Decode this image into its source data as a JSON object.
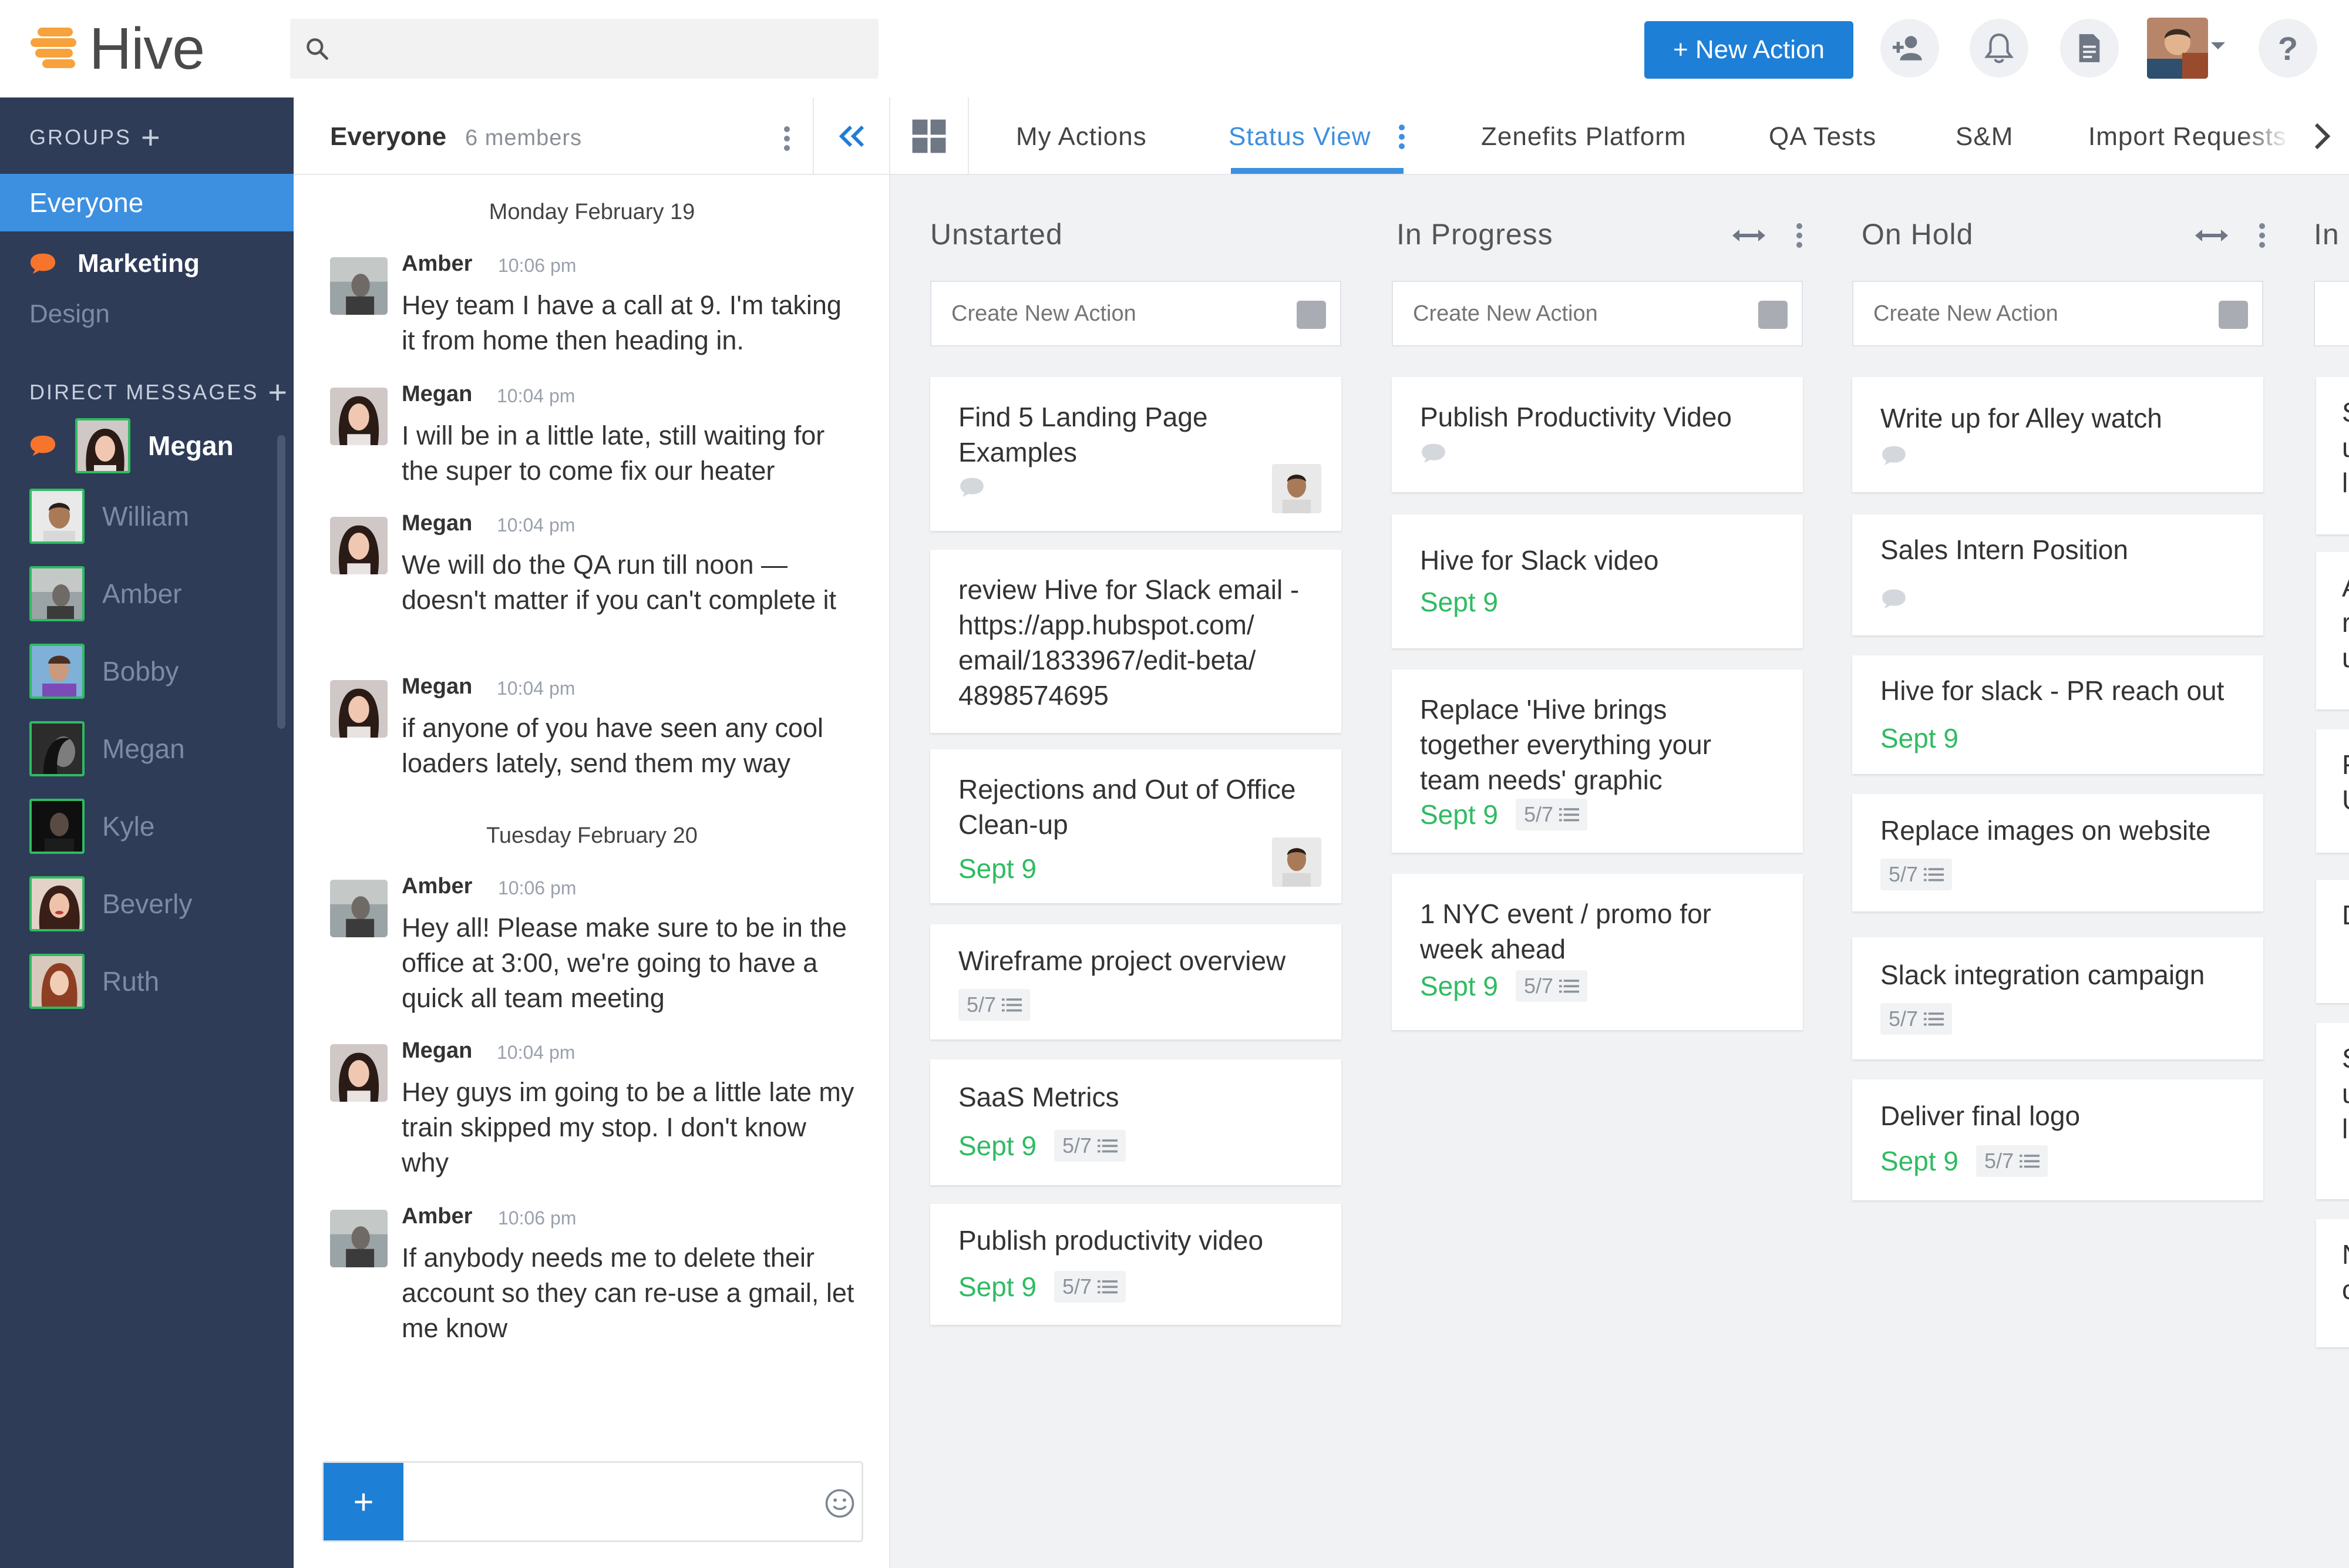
{
  "app": {
    "name": "Hive",
    "brand_color": "#f7a23c",
    "accent_color": "#1e7fd6",
    "done_color": "#2fbb62"
  },
  "topbar": {
    "search_placeholder": "",
    "new_action_label": "+ New Action",
    "icons": [
      "add-user-icon",
      "bell-icon",
      "document-icon",
      "help-icon"
    ],
    "help_label": "?"
  },
  "sidebar": {
    "groups_heading": "GROUPS",
    "groups": [
      {
        "label": "Everyone",
        "selected": true
      },
      {
        "label": "Marketing",
        "unread": true
      },
      {
        "label": "Design"
      }
    ],
    "dm_heading": "DIRECT MESSAGES",
    "direct_messages": [
      {
        "label": "Megan",
        "active": true
      },
      {
        "label": "William"
      },
      {
        "label": "Amber"
      },
      {
        "label": "Bobby"
      },
      {
        "label": "Megan"
      },
      {
        "label": "Kyle"
      },
      {
        "label": "Beverly"
      },
      {
        "label": "Ruth"
      }
    ]
  },
  "chat": {
    "title": "Everyone",
    "members": "6 members",
    "days": [
      {
        "label": "Monday February 19",
        "messages": [
          {
            "author": "Amber",
            "time": "10:06 pm",
            "text": "Hey team I have a call at 9. I'm taking it from home then heading in."
          },
          {
            "author": "Megan",
            "time": "10:04 pm",
            "text": "I will be in a little late, still waiting for the super to come fix our heater"
          },
          {
            "author": "Megan",
            "time": "10:04 pm",
            "text": "We will do the QA run till noon — doesn't matter if you can't complete it"
          },
          {
            "author": "Megan",
            "time": "10:04 pm",
            "text": "if anyone of you have seen any cool loaders lately, send them my way"
          }
        ]
      },
      {
        "label": "Tuesday February 20",
        "messages": [
          {
            "author": "Amber",
            "time": "10:06 pm",
            "text": "Hey all! Please make sure to be in the office at 3:00, we're going to have a quick all team meeting"
          },
          {
            "author": "Megan",
            "time": "10:04 pm",
            "text": "Hey guys im going to be a little late my train skipped my stop. I don't know why"
          },
          {
            "author": "Amber",
            "time": "10:06 pm",
            "text": "If anybody needs me to delete their account so they can re-use a gmail, let me know"
          }
        ]
      }
    ],
    "composer": {
      "add_label": "+",
      "placeholder": ""
    }
  },
  "tabs": [
    {
      "label": "My Actions"
    },
    {
      "label": "Status View",
      "active": true
    },
    {
      "label": "Zenefits Platform"
    },
    {
      "label": "QA Tests"
    },
    {
      "label": "S&M"
    },
    {
      "label": "Import Requests"
    }
  ],
  "board": {
    "create_placeholder": "Create New Action",
    "columns": [
      {
        "title": "Unstarted",
        "cards": [
          {
            "title": "Find 5 Landing Page Examples",
            "comments": true,
            "assignee": true
          },
          {
            "title": "review Hive for Slack email - https://app.hubspot.com/ email/1833967/edit-beta/ 4898574695"
          },
          {
            "title": "Rejections and Out of Office Clean-up",
            "due": "Sept 9",
            "assignee": true
          },
          {
            "title": "Wireframe project overview",
            "subtasks": "5/7"
          },
          {
            "title": "SaaS Metrics",
            "due": "Sept 9",
            "subtasks": "5/7"
          },
          {
            "title": "Publish productivity video",
            "due": "Sept 9",
            "subtasks": "5/7"
          }
        ]
      },
      {
        "title": "In Progress",
        "cards": [
          {
            "title": "Publish Productivity Video",
            "comments": true
          },
          {
            "title": "Hive for Slack video",
            "due": "Sept 9"
          },
          {
            "title": "Replace 'Hive brings together everything your team needs' graphic",
            "due": "Sept 9",
            "subtasks": "5/7"
          },
          {
            "title": "1 NYC event / promo for week ahead",
            "due": "Sept 9",
            "subtasks": "5/7"
          }
        ]
      },
      {
        "title": "On Hold",
        "cards": [
          {
            "title": "Write up for Alley watch",
            "comments": true
          },
          {
            "title": "Sales Intern Position",
            "comments": true
          },
          {
            "title": "Hive for slack - PR reach out",
            "due": "Sept 9"
          },
          {
            "title": "Replace images on website",
            "subtasks": "5/7"
          },
          {
            "title": "Slack integration campaign",
            "subtasks": "5/7"
          },
          {
            "title": "Deliver final logo",
            "due": "Sept 9",
            "subtasks": "5/7"
          }
        ]
      },
      {
        "title": "In",
        "peek_cards": [
          "S\nu\nl",
          "A\nr\nu",
          "F\nU",
          "D",
          "S\nu\nl",
          "N\nc"
        ]
      }
    ]
  }
}
